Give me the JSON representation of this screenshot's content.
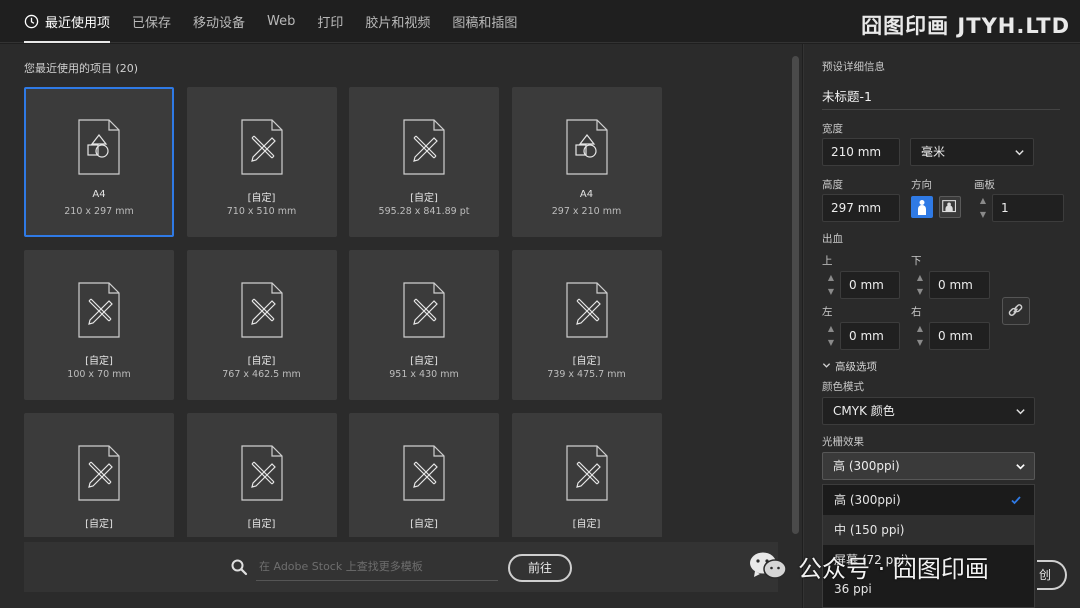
{
  "watermark": "囧图印画 JTYH.LTD",
  "tabs": [
    {
      "label": "最近使用项"
    },
    {
      "label": "已保存"
    },
    {
      "label": "移动设备"
    },
    {
      "label": "Web"
    },
    {
      "label": "打印"
    },
    {
      "label": "胶片和视频"
    },
    {
      "label": "图稿和插图"
    }
  ],
  "recent": {
    "title": "您最近使用的项目 (20)",
    "items": [
      {
        "name": "A4",
        "size": "210 x 297 mm",
        "icon": "shapes-doc-icon"
      },
      {
        "name": "[自定]",
        "size": "710 x 510 mm",
        "icon": "pencil-doc-icon"
      },
      {
        "name": "[自定]",
        "size": "595.28 x 841.89 pt",
        "icon": "pencil-doc-icon"
      },
      {
        "name": "A4",
        "size": "297 x 210 mm",
        "icon": "shapes-doc-icon"
      },
      {
        "name": "[自定]",
        "size": "100 x 70 mm",
        "icon": "pencil-doc-icon"
      },
      {
        "name": "[自定]",
        "size": "767 x 462.5 mm",
        "icon": "pencil-doc-icon"
      },
      {
        "name": "[自定]",
        "size": "951 x 430 mm",
        "icon": "pencil-doc-icon"
      },
      {
        "name": "[自定]",
        "size": "739 x 475.7 mm",
        "icon": "pencil-doc-icon"
      },
      {
        "name": "[自定]",
        "size": "",
        "icon": "pencil-doc-icon"
      },
      {
        "name": "[自定]",
        "size": "",
        "icon": "pencil-doc-icon"
      },
      {
        "name": "[自定]",
        "size": "",
        "icon": "pencil-doc-icon"
      },
      {
        "name": "[自定]",
        "size": "",
        "icon": "pencil-doc-icon"
      }
    ]
  },
  "search": {
    "placeholder": "在 Adobe Stock 上查找更多模板",
    "go_label": "前往"
  },
  "preset": {
    "section_title": "预设详细信息",
    "doc_name": "未标题-1",
    "width_label": "宽度",
    "width_value": "210 mm",
    "unit_value": "毫米",
    "height_label": "高度",
    "height_value": "297 mm",
    "orientation_label": "方向",
    "artboards_label": "画板",
    "artboards_value": "1",
    "bleed_label": "出血",
    "bleed_top_label": "上",
    "bleed_top": "0 mm",
    "bleed_bottom_label": "下",
    "bleed_bottom": "0 mm",
    "bleed_left_label": "左",
    "bleed_left": "0 mm",
    "bleed_right_label": "右",
    "bleed_right": "0 mm",
    "advanced_label": "高级选项",
    "color_mode_label": "颜色模式",
    "color_mode_value": "CMYK 颜色",
    "raster_label": "光栅效果",
    "raster_value": "高 (300ppi)",
    "raster_options": [
      "高 (300ppi)",
      "中 (150 ppi)",
      "屏幕 (72 ppi)",
      "36 ppi"
    ],
    "create_label": "创"
  },
  "overlay": {
    "wechat_text": "公众号 · 囧图印画"
  },
  "colors": {
    "accent": "#2f7ae5"
  }
}
